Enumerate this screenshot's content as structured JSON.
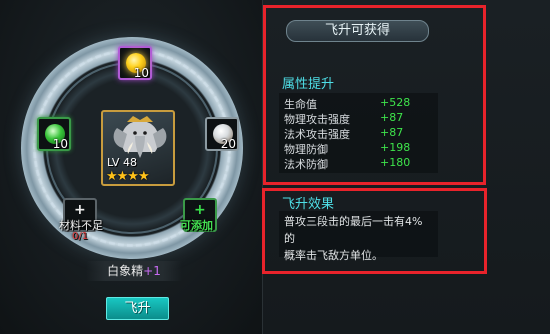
{
  "panel_title": "飞升可获得",
  "attributes": {
    "header": "属性提升",
    "rows": [
      {
        "name": "生命值",
        "value": "+528"
      },
      {
        "name": "物理攻击强度",
        "value": "+87"
      },
      {
        "name": "法术攻击强度",
        "value": "+87"
      },
      {
        "name": "物理防御",
        "value": "+198"
      },
      {
        "name": "法术防御",
        "value": "+180"
      }
    ]
  },
  "effect": {
    "header": "飞升效果",
    "line1": "普攻三段击的最后一击有4%的",
    "line2": "概率击飞敌方单位。"
  },
  "hero": {
    "level": "LV 48",
    "stars": "★★★★",
    "name": "白象精",
    "name_plus": "+1"
  },
  "slots": {
    "top_count": "10",
    "left_count": "10",
    "right_count": "20",
    "bottom_left_label": "材料不足",
    "bottom_left_count": "0/1",
    "bottom_right_label": "可添加"
  },
  "ascend_button_label": "飞升",
  "colors": {
    "accent_cyan": "#4fdfe7",
    "bonus_green": "#3ee34b",
    "warning_red": "#e23a3a",
    "highlight_red": "#e8232b",
    "button_teal": "#14b3af"
  }
}
